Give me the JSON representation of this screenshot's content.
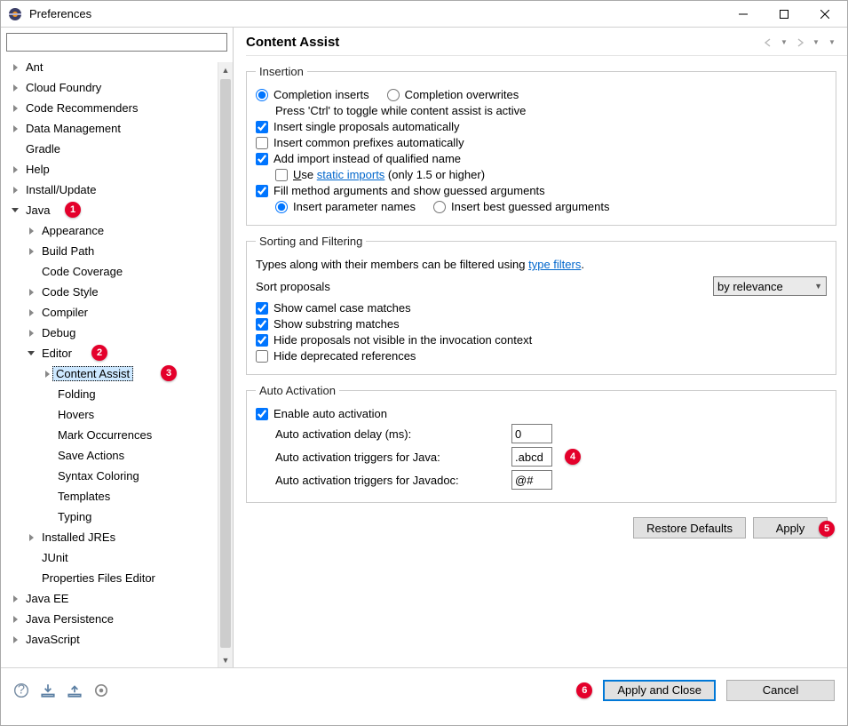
{
  "window": {
    "title": "Preferences"
  },
  "filter": {
    "placeholder": ""
  },
  "tree": [
    {
      "label": "Ant",
      "depth": 0,
      "expandable": true,
      "expanded": false
    },
    {
      "label": "Cloud Foundry",
      "depth": 0,
      "expandable": true,
      "expanded": false
    },
    {
      "label": "Code Recommenders",
      "depth": 0,
      "expandable": true,
      "expanded": false
    },
    {
      "label": "Data Management",
      "depth": 0,
      "expandable": true,
      "expanded": false
    },
    {
      "label": "Gradle",
      "depth": 0,
      "expandable": false
    },
    {
      "label": "Help",
      "depth": 0,
      "expandable": true,
      "expanded": false
    },
    {
      "label": "Install/Update",
      "depth": 0,
      "expandable": true,
      "expanded": false
    },
    {
      "label": "Java",
      "depth": 0,
      "expandable": true,
      "expanded": true,
      "badge": 1,
      "badgeDx": 70
    },
    {
      "label": "Appearance",
      "depth": 1,
      "expandable": true,
      "expanded": false
    },
    {
      "label": "Build Path",
      "depth": 1,
      "expandable": true,
      "expanded": false
    },
    {
      "label": "Code Coverage",
      "depth": 1,
      "expandable": false
    },
    {
      "label": "Code Style",
      "depth": 1,
      "expandable": true,
      "expanded": false
    },
    {
      "label": "Compiler",
      "depth": 1,
      "expandable": true,
      "expanded": false
    },
    {
      "label": "Debug",
      "depth": 1,
      "expandable": true,
      "expanded": false
    },
    {
      "label": "Editor",
      "depth": 1,
      "expandable": true,
      "expanded": true,
      "badge": 2,
      "badgeDx": 100
    },
    {
      "label": "Content Assist",
      "depth": 2,
      "expandable": true,
      "expanded": false,
      "selected": true,
      "badge": 3,
      "badgeDx": 178
    },
    {
      "label": "Folding",
      "depth": 2,
      "expandable": false
    },
    {
      "label": "Hovers",
      "depth": 2,
      "expandable": false
    },
    {
      "label": "Mark Occurrences",
      "depth": 2,
      "expandable": false
    },
    {
      "label": "Save Actions",
      "depth": 2,
      "expandable": false
    },
    {
      "label": "Syntax Coloring",
      "depth": 2,
      "expandable": false
    },
    {
      "label": "Templates",
      "depth": 2,
      "expandable": false
    },
    {
      "label": "Typing",
      "depth": 2,
      "expandable": false
    },
    {
      "label": "Installed JREs",
      "depth": 1,
      "expandable": true,
      "expanded": false
    },
    {
      "label": "JUnit",
      "depth": 1,
      "expandable": false
    },
    {
      "label": "Properties Files Editor",
      "depth": 1,
      "expandable": false
    },
    {
      "label": "Java EE",
      "depth": 0,
      "expandable": true,
      "expanded": false
    },
    {
      "label": "Java Persistence",
      "depth": 0,
      "expandable": true,
      "expanded": false
    },
    {
      "label": "JavaScript",
      "depth": 0,
      "expandable": true,
      "expanded": false
    }
  ],
  "page": {
    "title": "Content Assist",
    "insertion": {
      "legend": "Insertion",
      "completionInserts": "Completion inserts",
      "completionOverwrites": "Completion overwrites",
      "toggleHint": "Press 'Ctrl' to toggle while content assist is active",
      "insertSingle": "Insert single proposals automatically",
      "insertCommon": "Insert common prefixes automatically",
      "addImport": "Add import instead of qualified name",
      "useStaticPrefixChar": "U",
      "useStaticPrefixRest": "se ",
      "useStaticLink": "static imports",
      "useStaticSuffix": " (only 1.5 or higher)",
      "fillMethod": "Fill method arguments and show guessed arguments",
      "insertParamNames": "Insert parameter names",
      "insertBestGuessed": "Insert best guessed arguments"
    },
    "sorting": {
      "legend": "Sorting and Filtering",
      "typesHintPrefix": "Types along with their members can be filtered using ",
      "typeFiltersLink": "type filters",
      "sortLabel": "Sort proposals",
      "sortValue": "by relevance",
      "showCamel": "Show camel case matches",
      "showSubstring": "Show substring matches",
      "hideProposals": "Hide proposals not visible in the invocation context",
      "hideDeprecated": "Hide deprecated references"
    },
    "auto": {
      "legend": "Auto Activation",
      "enable": "Enable auto activation",
      "delayLabel": "Auto activation delay (ms):",
      "delayValue": "0",
      "triggersJavaLabel": "Auto activation triggers for Java:",
      "triggersJavaValue": ".abcd",
      "triggersJavaBadge": 4,
      "triggersJavadocLabel": "Auto activation triggers for Javadoc:",
      "triggersJavadocValue": "@#"
    },
    "buttons": {
      "restore": "Restore Defaults",
      "apply": "Apply",
      "applyClose": "Apply and Close",
      "cancel": "Cancel",
      "applyBadge": 5,
      "applyCloseBadge": 6
    }
  }
}
